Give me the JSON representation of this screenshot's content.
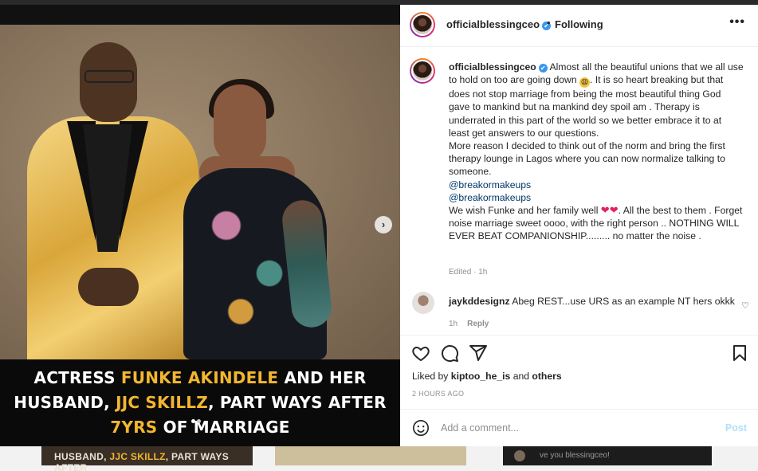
{
  "photo": {
    "caption_parts": [
      {
        "text": "ACTRESS ",
        "gold": false
      },
      {
        "text": "FUNKE AKINDELE",
        "gold": true
      },
      {
        "text": " AND HER",
        "gold": false
      }
    ],
    "caption_line2": [
      {
        "text": "HUSBAND, ",
        "gold": false
      },
      {
        "text": "JJC SKILLZ",
        "gold": true
      },
      {
        "text": ", PART WAYS AFTER",
        "gold": false
      }
    ],
    "caption_line3": [
      {
        "text": "7YRS",
        "gold": true
      },
      {
        "text": " OF MARRIAGE",
        "gold": false
      }
    ],
    "next_icon": "chevron-right-icon"
  },
  "background": {
    "card_a_parts": [
      "HUSBAND, ",
      "JJC SKILLZ",
      ", PART WAYS AFTER"
    ],
    "card_c_text": "ve you blessingceo!"
  },
  "header": {
    "username": "officialblessingceo",
    "verified": "✔",
    "separator": "•",
    "follow_status": "Following",
    "more": "•••"
  },
  "caption": {
    "username": "officialblessingceo",
    "verified": "✔",
    "text_1": "Almost all the beautiful unions that we all use to hold on too are going down",
    "emoji_1": "😩",
    "text_2": ". It is so heart breaking but that does not stop marriage from being the most beautiful thing God gave to mankind but na mankind dey spoil am . Therapy is underrated in this part of the world so we better embrace it to at least get answers to our questions.",
    "text_3": "More reason I decided to think out of the norm and bring the first therapy lounge in Lagos where you can now normalize talking to someone.",
    "mention_1": "@breakormakeups",
    "mention_2": "@breakormakeups",
    "text_4": "We wish Funke and her family well",
    "hearts": "❤❤",
    "text_5": ". All the best to them . Forget noise marriage sweet oooo, with the right person .. NOTHING WILL EVER BEAT COMPANIONSHIP......... no matter the noise .",
    "edited": "Edited · 1h"
  },
  "comment": {
    "username": "jaykddesignz",
    "text": "Abeg REST...use URS as an example NT hers okkk",
    "time": "1h",
    "reply": "Reply",
    "like_icon": "♡"
  },
  "actions": {
    "icons": [
      "heart-icon",
      "comment-icon",
      "share-icon",
      "bookmark-icon"
    ]
  },
  "likes": {
    "prefix": "Liked by",
    "user": "kiptoo_he_is",
    "and": "and",
    "others": "others"
  },
  "time_ago": "2 HOURS AGO",
  "add_comment": {
    "placeholder": "Add a comment...",
    "post": "Post"
  },
  "colors": {
    "gold": "#f2b630",
    "verified": "#3897f0",
    "post_disabled": "#b2dffc",
    "mention": "#00376b",
    "heart": "#e0245e"
  }
}
